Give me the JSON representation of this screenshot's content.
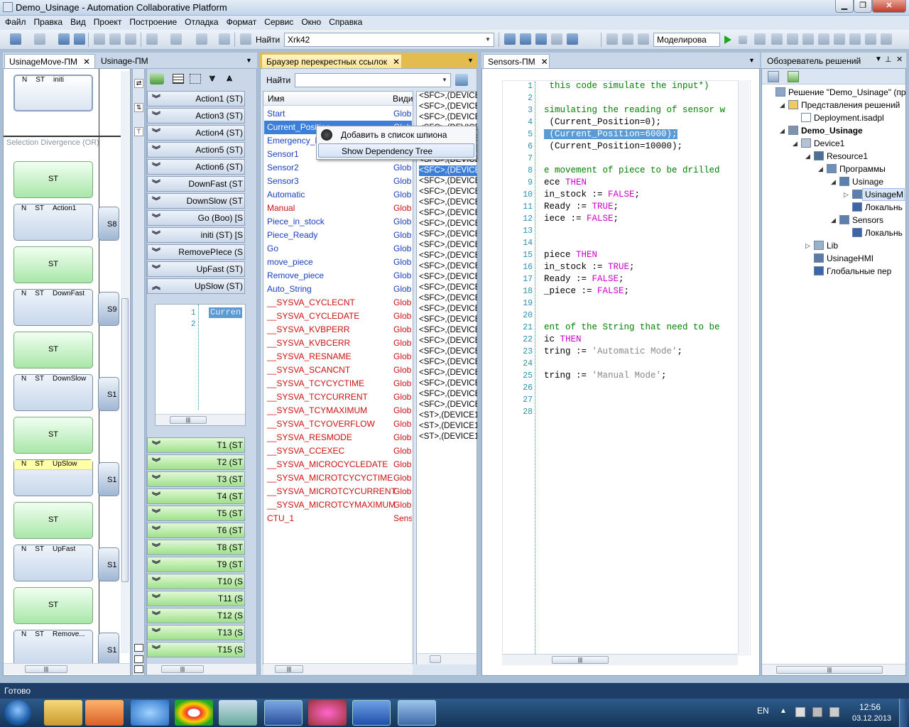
{
  "window": {
    "title": "Demo_Usinage - Automation Collaborative Platform"
  },
  "menu": [
    "Файл",
    "Правка",
    "Вид",
    "Проект",
    "Построение",
    "Отладка",
    "Формат",
    "Сервис",
    "Окно",
    "Справка"
  ],
  "toolbar": {
    "find_label": "Найти",
    "find_value": "Xrk42",
    "mode_value": "Моделирова"
  },
  "tabs": {
    "left1": "UsinageMove-ПМ",
    "left2": "Usinage-ПМ",
    "xref": "Браузер перекрестных ссылок",
    "sensors": "Sensors-ПМ",
    "solution": "Обозреватель решений"
  },
  "sfc": {
    "divergence_label": "Selection Divergence (OR)",
    "steps": [
      {
        "type": "N",
        "kind": "ST",
        "name": "initi"
      },
      {
        "center": "ST"
      },
      {
        "type": "N",
        "kind": "ST",
        "name": "Action1"
      },
      {
        "center": "ST"
      },
      {
        "type": "N",
        "kind": "ST",
        "name": "DownFast"
      },
      {
        "center": "ST"
      },
      {
        "type": "N",
        "kind": "ST",
        "name": "DownSlow"
      },
      {
        "center": "ST"
      },
      {
        "type": "N",
        "kind": "ST",
        "name": "UpSlow"
      },
      {
        "center": "ST"
      },
      {
        "type": "N",
        "kind": "ST",
        "name": "UpFast"
      },
      {
        "center": "ST"
      },
      {
        "type": "N",
        "kind": "ST",
        "name": "Remove..."
      }
    ],
    "side_labels": [
      "S8",
      "S9",
      "S1",
      "S1",
      "S1",
      "S1"
    ]
  },
  "actions": [
    {
      "label": "Action1 (ST)"
    },
    {
      "label": "Action3 (ST)"
    },
    {
      "label": "Action4 (ST)"
    },
    {
      "label": "Action5 (ST)"
    },
    {
      "label": "Action6 (ST)"
    },
    {
      "label": "DownFast (ST"
    },
    {
      "label": "DownSlow (ST"
    },
    {
      "label": "Go (Boo) [S"
    },
    {
      "label": "initi (ST) [S"
    },
    {
      "label": "RemovePIece (S"
    },
    {
      "label": "UpFast (ST)"
    },
    {
      "label": "UpSlow (ST)"
    }
  ],
  "mini_code": {
    "lines": [
      "1",
      "2"
    ],
    "text": "Curren"
  },
  "transitions": [
    "T1 (ST",
    "T2 (ST",
    "T3 (ST",
    "T4 (ST",
    "T5 (ST",
    "T6 (ST",
    "T8 (ST",
    "T9 (ST",
    "T10 (S",
    "T11 (S",
    "T12 (S",
    "T13 (S",
    "T15 (S"
  ],
  "xref": {
    "find_label": "Найти",
    "col_name": "Имя",
    "col_scope": "Види",
    "rows": [
      {
        "name": "Start",
        "scope": "Glob",
        "color": "#1a3fbf"
      },
      {
        "name": "Current_Position",
        "scope": "Glob",
        "color": "#ffffff"
      },
      {
        "name": "Emergency_Halt",
        "scope": "Glob",
        "color": "#1a3fbf"
      },
      {
        "name": "Sensor1",
        "scope": "Glob",
        "color": "#1a3fbf"
      },
      {
        "name": "Sensor2",
        "scope": "Glob",
        "color": "#1a3fbf"
      },
      {
        "name": "Sensor3",
        "scope": "Glob",
        "color": "#1a3fbf"
      },
      {
        "name": "Automatic",
        "scope": "Glob",
        "color": "#1a3fbf"
      },
      {
        "name": "Manual",
        "scope": "Glob",
        "color": "#cc1111"
      },
      {
        "name": "Piece_in_stock",
        "scope": "Glob",
        "color": "#1a3fbf"
      },
      {
        "name": "Piece_Ready",
        "scope": "Glob",
        "color": "#1a3fbf"
      },
      {
        "name": "Go",
        "scope": "Glob",
        "color": "#1a3fbf"
      },
      {
        "name": "move_piece",
        "scope": "Glob",
        "color": "#1a3fbf"
      },
      {
        "name": "Remove_piece",
        "scope": "Glob",
        "color": "#1a3fbf"
      },
      {
        "name": "Auto_String",
        "scope": "Glob",
        "color": "#1a3fbf"
      },
      {
        "name": "__SYSVA_CYCLECNT",
        "scope": "Glob",
        "color": "#cc1111"
      },
      {
        "name": "__SYSVA_CYCLEDATE",
        "scope": "Glob",
        "color": "#cc1111"
      },
      {
        "name": "__SYSVA_KVBPERR",
        "scope": "Glob",
        "color": "#cc1111"
      },
      {
        "name": "__SYSVA_KVBCERR",
        "scope": "Glob",
        "color": "#cc1111"
      },
      {
        "name": "__SYSVA_RESNAME",
        "scope": "Glob",
        "color": "#cc1111"
      },
      {
        "name": "__SYSVA_SCANCNT",
        "scope": "Glob",
        "color": "#cc1111"
      },
      {
        "name": "__SYSVA_TCYCYCTIME",
        "scope": "Glob",
        "color": "#cc1111"
      },
      {
        "name": "__SYSVA_TCYCURRENT",
        "scope": "Glob",
        "color": "#cc1111"
      },
      {
        "name": "__SYSVA_TCYMAXIMUM",
        "scope": "Glob",
        "color": "#cc1111"
      },
      {
        "name": "__SYSVA_TCYOVERFLOW",
        "scope": "Glob",
        "color": "#cc1111"
      },
      {
        "name": "__SYSVA_RESMODE",
        "scope": "Glob",
        "color": "#cc1111"
      },
      {
        "name": "__SYSVA_CCEXEC",
        "scope": "Glob",
        "color": "#cc1111"
      },
      {
        "name": "__SYSVA_MICROCYCLEDATE",
        "scope": "Glob",
        "color": "#cc1111"
      },
      {
        "name": "__SYSVA_MICROTCYCYCTIME",
        "scope": "Glob",
        "color": "#cc1111"
      },
      {
        "name": "__SYSVA_MICROTCYCURRENT",
        "scope": "Glob",
        "color": "#cc1111"
      },
      {
        "name": "__SYSVA_MICROTCYMAXIMUM",
        "scope": "Glob",
        "color": "#cc1111"
      },
      {
        "name": "CTU_1",
        "scope": "Sens",
        "color": "#cc1111"
      }
    ],
    "refs": [
      "<SFC>,(DEVICE",
      "<SFC>,(DEVICE",
      "<SFC>,(DEVICE",
      "<SFC>,(DEVICE",
      "<SFC>,(DEVICE",
      "<SFC>,(DEVICE",
      "<SFC>,(DEVICE",
      "<SFC>,(DEVICE",
      "<SFC>,(DEVICE",
      "<SFC>,(DEVICE",
      "<SFC>,(DEVICE",
      "<SFC>,(DEVICE",
      "<SFC>,(DEVICE",
      "<SFC>,(DEVICE",
      "<SFC>,(DEVICE",
      "<SFC>,(DEVICE",
      "<SFC>,(DEVICE",
      "<SFC>,(DEVICE",
      "<SFC>,(DEVICE",
      "<SFC>,(DEVICE",
      "<SFC>,(DEVICE",
      "<SFC>,(DEVICE",
      "<SFC>,(DEVICE",
      "<SFC>,(DEVICE",
      "<SFC>,(DEVICE",
      "<SFC>,(DEVICE",
      "<SFC>,(DEVICE",
      "<SFC>,(DEVICE",
      "<SFC>,(DEVICE",
      "<SFC>,(DEVICE",
      "<ST>,(DEVICE1,",
      "<ST>,(DEVICE1,",
      "<ST>,(DEVICE1,"
    ]
  },
  "context_menu": {
    "item1": "Добавить в список шпиона",
    "item2": "Show Dependency Tree"
  },
  "code": {
    "lines": [
      {
        "n": "1",
        "segs": [
          {
            "t": " this code simulate the input*)",
            "c": "#008000"
          }
        ]
      },
      {
        "n": "2",
        "segs": []
      },
      {
        "n": "3",
        "segs": [
          {
            "t": "simulating the reading of sensor w",
            "c": "#008000"
          }
        ]
      },
      {
        "n": "4",
        "segs": [
          {
            "t": " (Current_Position=0);",
            "c": "#000"
          }
        ]
      },
      {
        "n": "5",
        "segs": [
          {
            "t": " (Current_Position=6000);",
            "c": "#ffffff",
            "hl": true
          }
        ]
      },
      {
        "n": "6",
        "segs": [
          {
            "t": " (Current_Position=10000);",
            "c": "#000"
          }
        ]
      },
      {
        "n": "7",
        "segs": []
      },
      {
        "n": "8",
        "segs": [
          {
            "t": "e movement of piece to be drilled ",
            "c": "#008000"
          }
        ]
      },
      {
        "n": "9",
        "segs": [
          {
            "t": "ece ",
            "c": "#000"
          },
          {
            "t": "THEN",
            "c": "#cc00cc"
          }
        ]
      },
      {
        "n": "10",
        "segs": [
          {
            "t": "in_stock := ",
            "c": "#000"
          },
          {
            "t": "FALSE",
            "c": "#cc00cc"
          },
          {
            "t": ";",
            "c": "#000"
          }
        ]
      },
      {
        "n": "11",
        "segs": [
          {
            "t": "Ready := ",
            "c": "#000"
          },
          {
            "t": "TRUE",
            "c": "#cc00cc"
          },
          {
            "t": ";",
            "c": "#000"
          }
        ]
      },
      {
        "n": "12",
        "segs": [
          {
            "t": "iece := ",
            "c": "#000"
          },
          {
            "t": "FALSE",
            "c": "#cc00cc"
          },
          {
            "t": ";",
            "c": "#000"
          }
        ]
      },
      {
        "n": "13",
        "segs": []
      },
      {
        "n": "14",
        "segs": []
      },
      {
        "n": "15",
        "segs": [
          {
            "t": "piece ",
            "c": "#000"
          },
          {
            "t": "THEN",
            "c": "#cc00cc"
          }
        ]
      },
      {
        "n": "16",
        "segs": [
          {
            "t": "in_stock := ",
            "c": "#000"
          },
          {
            "t": "TRUE",
            "c": "#cc00cc"
          },
          {
            "t": ";",
            "c": "#000"
          }
        ]
      },
      {
        "n": "17",
        "segs": [
          {
            "t": "Ready := ",
            "c": "#000"
          },
          {
            "t": "FALSE",
            "c": "#cc00cc"
          },
          {
            "t": ";",
            "c": "#000"
          }
        ]
      },
      {
        "n": "18",
        "segs": [
          {
            "t": "_piece := ",
            "c": "#000"
          },
          {
            "t": "FALSE",
            "c": "#cc00cc"
          },
          {
            "t": ";",
            "c": "#000"
          }
        ]
      },
      {
        "n": "19",
        "segs": []
      },
      {
        "n": "20",
        "segs": []
      },
      {
        "n": "21",
        "segs": [
          {
            "t": "ent of the String that need to be ",
            "c": "#008000"
          }
        ]
      },
      {
        "n": "22",
        "segs": [
          {
            "t": "ic ",
            "c": "#000"
          },
          {
            "t": "THEN",
            "c": "#cc00cc"
          }
        ]
      },
      {
        "n": "23",
        "segs": [
          {
            "t": "tring := ",
            "c": "#000"
          },
          {
            "t": "'Automatic Mode'",
            "c": "#888888"
          },
          {
            "t": ";",
            "c": "#000"
          }
        ]
      },
      {
        "n": "24",
        "segs": []
      },
      {
        "n": "25",
        "segs": [
          {
            "t": "tring := ",
            "c": "#000"
          },
          {
            "t": "'Manual Mode'",
            "c": "#888888"
          },
          {
            "t": ";",
            "c": "#000"
          }
        ]
      },
      {
        "n": "26",
        "segs": []
      },
      {
        "n": "27",
        "segs": []
      },
      {
        "n": "28",
        "segs": []
      }
    ]
  },
  "solution": {
    "items": [
      {
        "label": "Решение \"Demo_Usinage\"  (пр",
        "indent": 0,
        "arrow": "",
        "icon": "solution-icon",
        "bold": false
      },
      {
        "label": "Представления решений",
        "indent": 1,
        "arrow": "◢",
        "icon": "folder-icon",
        "bold": false
      },
      {
        "label": "Deployment.isadpl",
        "indent": 2,
        "arrow": "",
        "icon": "file-icon",
        "bold": false
      },
      {
        "label": "Demo_Usinage",
        "indent": 1,
        "arrow": "◢",
        "icon": "project-icon",
        "bold": true
      },
      {
        "label": "Device1",
        "indent": 2,
        "arrow": "◢",
        "icon": "device-icon",
        "bold": false
      },
      {
        "label": "Resource1",
        "indent": 3,
        "arrow": "◢",
        "icon": "resource-icon",
        "bold": false
      },
      {
        "label": "Программы",
        "indent": 4,
        "arrow": "◢",
        "icon": "programs-icon",
        "bold": false
      },
      {
        "label": "Usinage",
        "indent": 5,
        "arrow": "◢",
        "icon": "program-icon",
        "bold": false
      },
      {
        "label": "UsinageM",
        "indent": 6,
        "arrow": "▷",
        "icon": "program-icon",
        "bold": false,
        "selected": true
      },
      {
        "label": "Локальнь",
        "indent": 6,
        "arrow": "",
        "icon": "cube-icon",
        "bold": false
      },
      {
        "label": "Sensors",
        "indent": 5,
        "arrow": "◢",
        "icon": "program-icon",
        "bold": false
      },
      {
        "label": "Локальнь",
        "indent": 6,
        "arrow": "",
        "icon": "cube-icon",
        "bold": false
      },
      {
        "label": "Lib",
        "indent": 3,
        "arrow": "▷",
        "icon": "lib-icon",
        "bold": false
      },
      {
        "label": "UsinageHMI",
        "indent": 3,
        "arrow": "",
        "icon": "hmi-icon",
        "bold": false
      },
      {
        "label": "Глобальные пер",
        "indent": 3,
        "arrow": "",
        "icon": "cube-icon",
        "bold": false
      }
    ]
  },
  "status": {
    "text": "Готово"
  },
  "taskbar": {
    "lang": "EN",
    "time": "12:56",
    "date": "03.12.2013"
  }
}
